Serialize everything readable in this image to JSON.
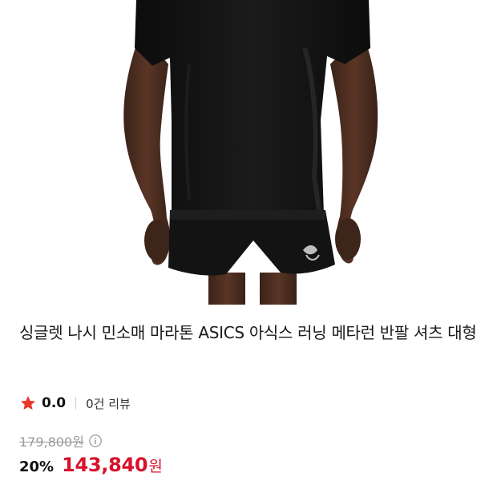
{
  "product": {
    "title": "싱글렛 나시 민소매 마라톤 ASICS 아식스 러닝 메타런 반팔 셔츠 대형",
    "image_alt": "ASICS running outfit",
    "rating": {
      "icon": "star-icon",
      "value": "0.0",
      "review_count_label": "0건 리뷰",
      "star_color": "#e8392c"
    },
    "price": {
      "original": "179,800원",
      "info_icon": "info-circle-icon",
      "discount_rate": "20%",
      "sale_amount": "143,840",
      "sale_unit": "원",
      "sale_color": "#d8122c"
    }
  }
}
